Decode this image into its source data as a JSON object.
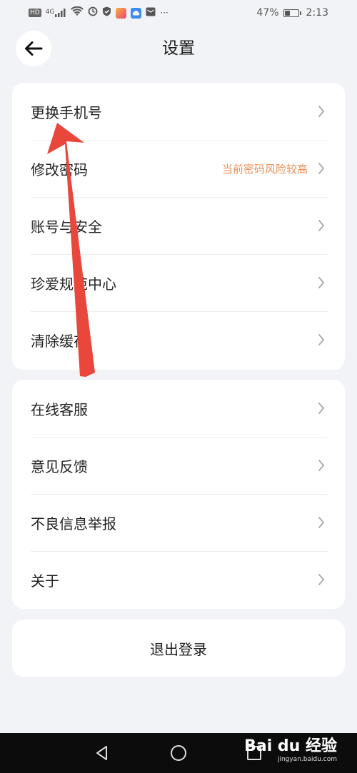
{
  "status_bar": {
    "left_chips": [
      "HD",
      "4G"
    ],
    "battery": "47%",
    "battery_level": 0.47,
    "time": "2:13",
    "more": "···"
  },
  "header": {
    "title": "设置"
  },
  "security_group": [
    {
      "label": "更换手机号",
      "hint": ""
    },
    {
      "label": "修改密码",
      "hint": "当前密码风险较高"
    },
    {
      "label": "账号与安全",
      "hint": ""
    },
    {
      "label": "珍爱规范中心",
      "hint": ""
    },
    {
      "label": "清除缓存",
      "hint": ""
    }
  ],
  "support_group": [
    {
      "label": "在线客服"
    },
    {
      "label": "意见反馈"
    },
    {
      "label": "不良信息举报"
    },
    {
      "label": "关于"
    }
  ],
  "logout": {
    "label": "退出登录"
  },
  "watermark": {
    "main": "Bai du 经验",
    "sub": "jingyan.baidu.com"
  },
  "colors": {
    "background": "#f2f3f7",
    "card": "#ffffff",
    "hint": "#e8915a",
    "arrow": "#e9473c",
    "nav_bar": "#0c0c0c"
  },
  "icons": {
    "back": "arrow-left-icon",
    "row": "chevron-right-icon",
    "nav": [
      "back-triangle-icon",
      "home-circle-icon",
      "recents-square-icon"
    ]
  }
}
